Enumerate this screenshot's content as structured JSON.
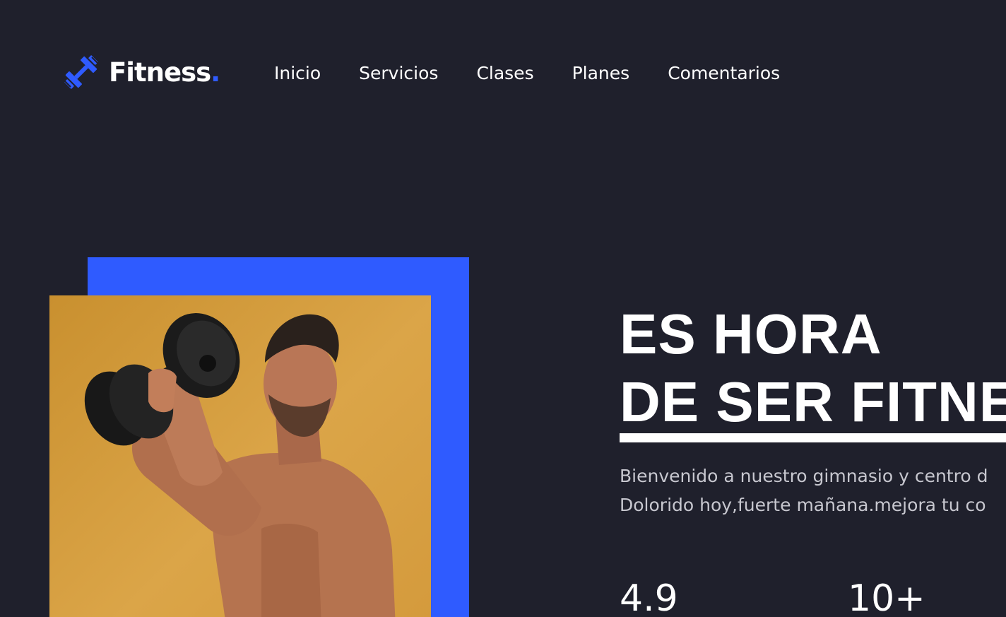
{
  "brand": {
    "name": "Fitness",
    "dot": ".",
    "accent_color": "#2f5bff",
    "icon": "dumbbell-icon"
  },
  "nav": {
    "items": [
      {
        "label": "Inicio"
      },
      {
        "label": "Servicios"
      },
      {
        "label": "Clases"
      },
      {
        "label": "Planes"
      },
      {
        "label": "Comentarios"
      }
    ]
  },
  "hero": {
    "title_line1": "ES HORA",
    "title_line2": "DE SER FITNE",
    "desc_line1": "Bienvenido a nuestro gimnasio y centro d",
    "desc_line2": "Dolorido hoy,fuerte mañana.mejora tu co",
    "image": "man-lifting-dumbbell-photo"
  },
  "stats": [
    {
      "value": "4.9"
    },
    {
      "value": "10+"
    }
  ],
  "colors": {
    "background": "#1f202c",
    "accent": "#2f5bff",
    "photo_background": "#d69d3f",
    "text": "#ffffff",
    "muted_text": "#c7c7cf"
  }
}
